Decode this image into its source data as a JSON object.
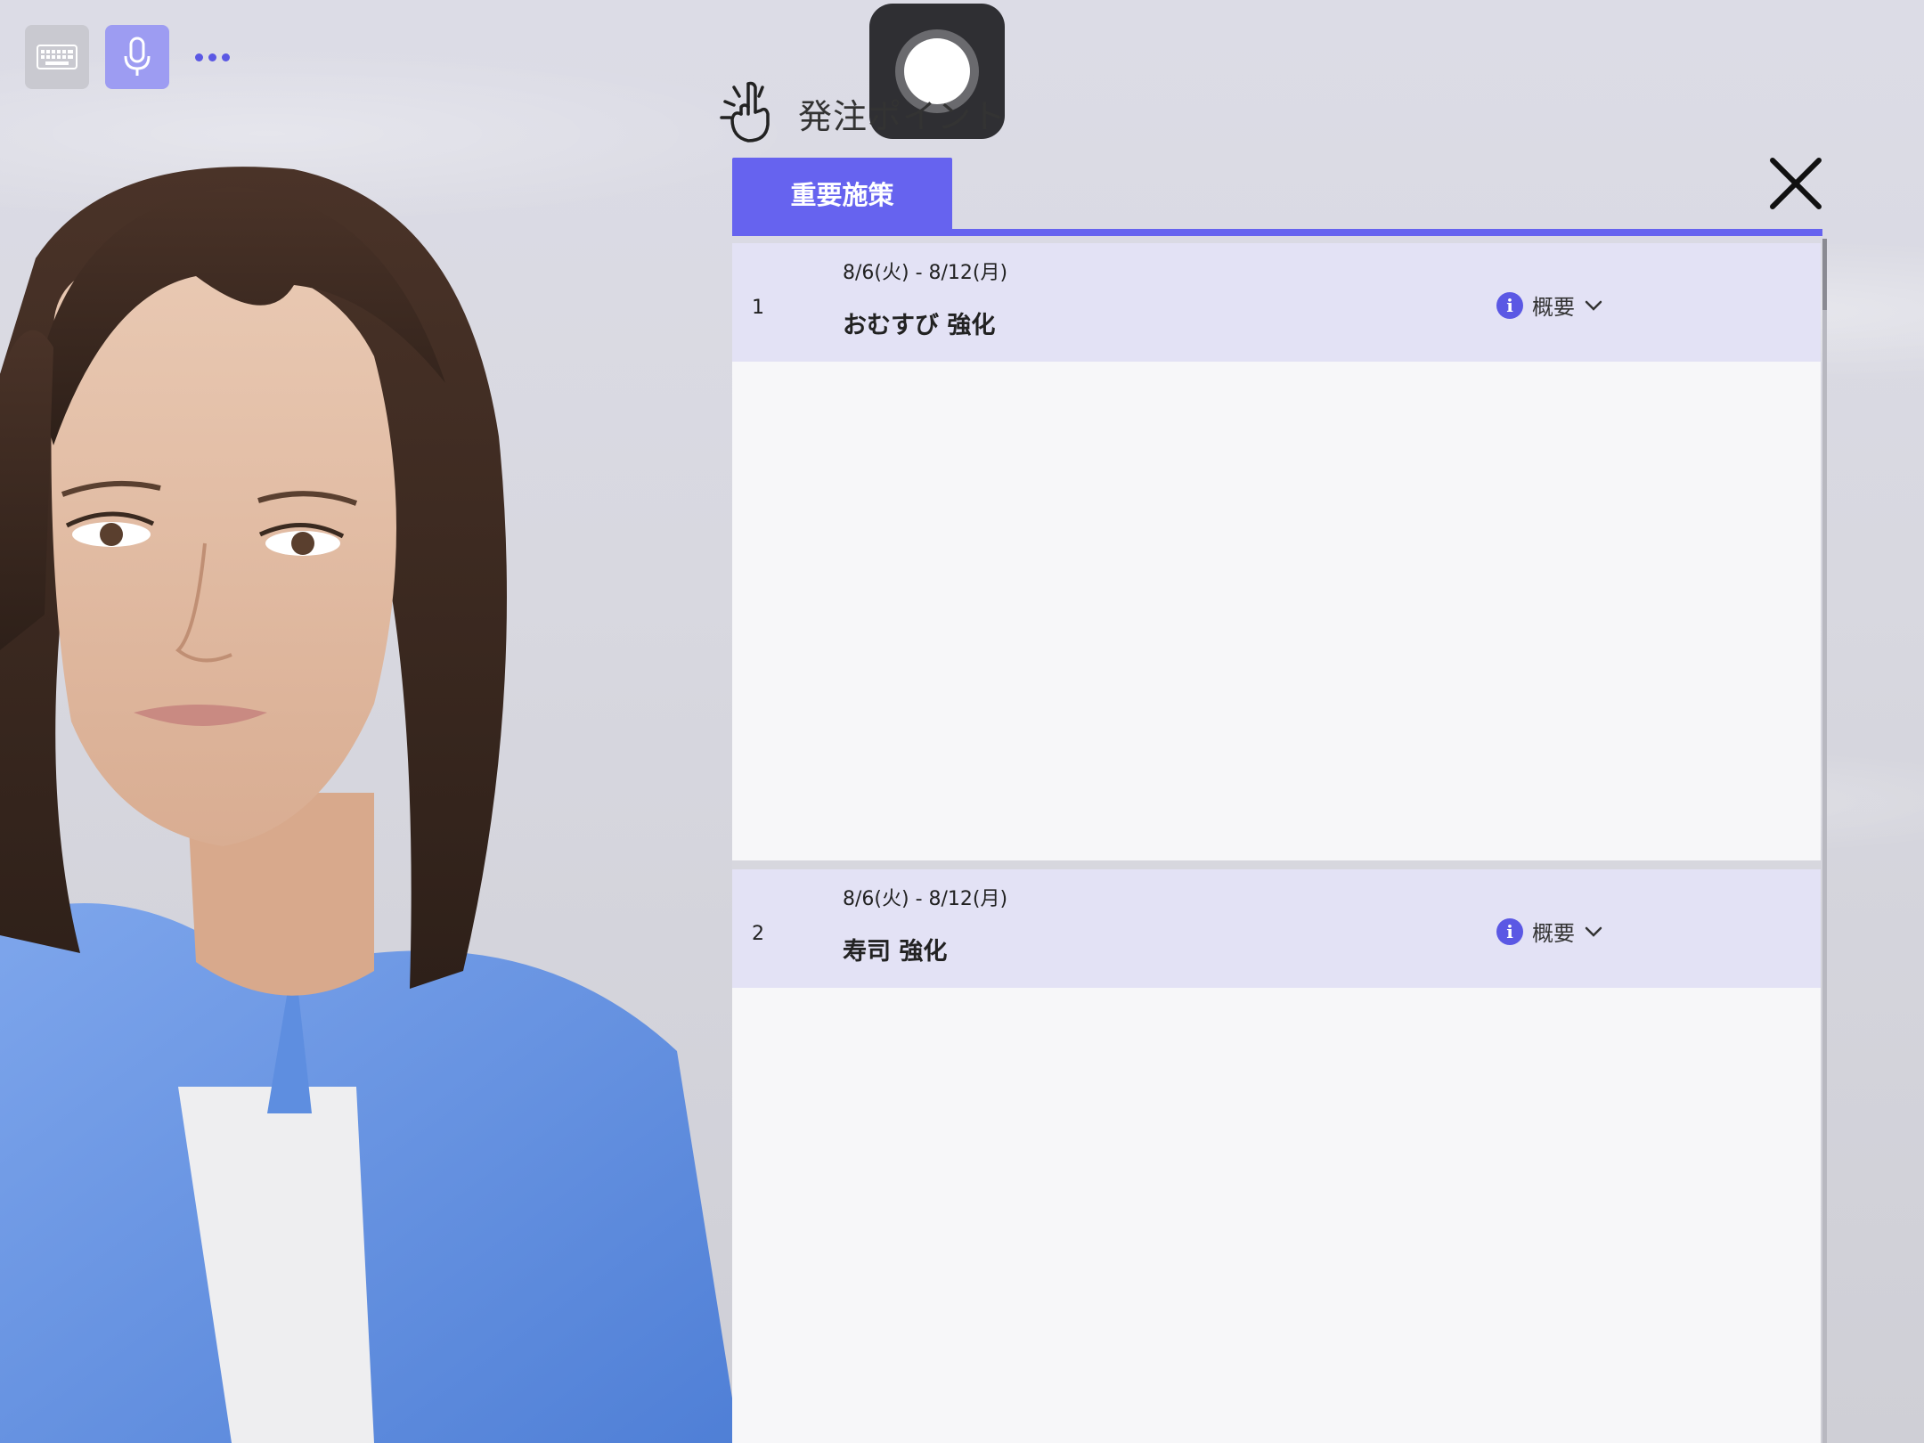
{
  "toolbar": {
    "keyboard_icon": "keyboard-icon",
    "mic_icon": "microphone-icon",
    "more_icon": "more-dots-icon",
    "accent_color": "#9d9cf2"
  },
  "header": {
    "title": "発注ポイント",
    "icon": "pointing-hand-icon"
  },
  "tabs": [
    {
      "label": "重要施策",
      "active": true
    }
  ],
  "close_icon": "close-icon",
  "items": [
    {
      "number": "1",
      "date": "8/6(火) - 8/12(月)",
      "title": "おむすび 強化",
      "summary_label": "概要"
    },
    {
      "number": "2",
      "date": "8/6(火) - 8/12(月)",
      "title": "寿司 強化",
      "summary_label": "概要"
    }
  ],
  "colors": {
    "brand": "#6663ef",
    "item_header": "#e3e2f5",
    "record_button": "#2f2f33"
  }
}
